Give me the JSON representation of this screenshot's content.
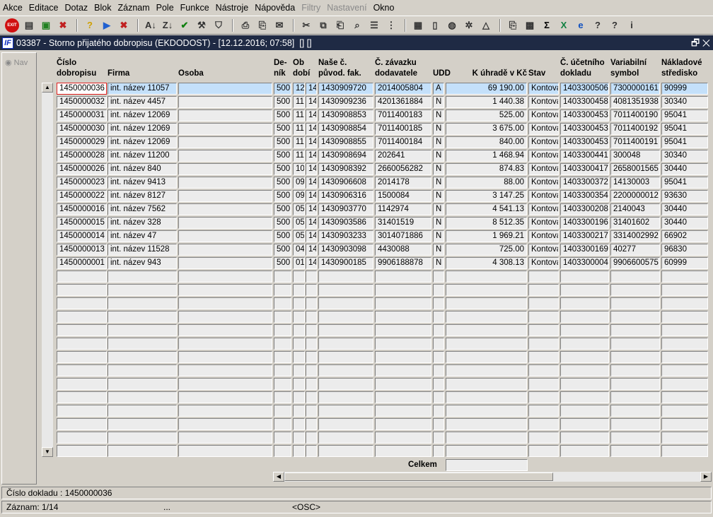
{
  "menu": [
    "Akce",
    "Editace",
    "Dotaz",
    "Blok",
    "Záznam",
    "Pole",
    "Funkce",
    "Nástroje",
    "Nápověda",
    "Filtry",
    "Nastavení",
    "Okno"
  ],
  "menu_disabled": [
    "Filtry",
    "Nastavení"
  ],
  "toolbar": [
    "exit",
    "insert-record",
    "save-record",
    "delete-record",
    "|",
    "query-help",
    "execute-query",
    "cancel-query",
    "|",
    "sort-asc",
    "sort-desc",
    "confirm",
    "tools",
    "filter",
    "|",
    "print",
    "print-setup",
    "mail",
    "|",
    "cut",
    "copy",
    "paste",
    "find",
    "list",
    "tree",
    "|",
    "doc1",
    "doc2",
    "globe",
    "settings",
    "warning",
    "|",
    "attach",
    "calc",
    "sum",
    "excel",
    "browser",
    "help",
    "help2",
    "info"
  ],
  "exit_label": "EXIT",
  "window": {
    "title": "03387 - Storno přijatého dobropisu (EKDODOST) - [12.12.2016; 07:58]  [] []",
    "logo": "IF"
  },
  "nav_label": "Nav",
  "headers": [
    "Číslo\ndobropisu",
    "Firma",
    "Osoba",
    "De-\nník",
    "Ob\ndobí",
    "",
    "Naše č.\npůvod. fak.",
    "Č. závazku\ndodavatele",
    "UDD",
    "K úhradě v Kč",
    "Stav",
    "Č. účetního\ndokladu",
    "Variabilní\nsymbol",
    "Nákladové\nstředisko"
  ],
  "rows": [
    [
      "1450000036",
      "int. název 11057",
      "",
      "500",
      "12",
      "14",
      "1430909720",
      "2014005804",
      "A",
      "69 190.00",
      "Kontová",
      "1403300506",
      "7300000161",
      "90999"
    ],
    [
      "1450000032",
      "int. název 4457",
      "",
      "500",
      "11",
      "14",
      "1430909236",
      "4201361884",
      "N",
      "1 440.38",
      "Kontová",
      "1403300458",
      "4081351938",
      "30340"
    ],
    [
      "1450000031",
      "int. název 12069",
      "",
      "500",
      "11",
      "14",
      "1430908853",
      "7011400183",
      "N",
      "525.00",
      "Kontová",
      "1403300453",
      "7011400190",
      "95041"
    ],
    [
      "1450000030",
      "int. název 12069",
      "",
      "500",
      "11",
      "14",
      "1430908854",
      "7011400185",
      "N",
      "3 675.00",
      "Kontová",
      "1403300453",
      "7011400192",
      "95041"
    ],
    [
      "1450000029",
      "int. název 12069",
      "",
      "500",
      "11",
      "14",
      "1430908855",
      "7011400184",
      "N",
      "840.00",
      "Kontová",
      "1403300453",
      "7011400191",
      "95041"
    ],
    [
      "1450000028",
      "int. název 11200",
      "",
      "500",
      "11",
      "14",
      "1430908694",
      "202641",
      "N",
      "1 468.94",
      "Kontová",
      "1403300441",
      "300048",
      "30340"
    ],
    [
      "1450000026",
      "int. název 840",
      "",
      "500",
      "10",
      "14",
      "1430908392",
      "2660056282",
      "N",
      "874.83",
      "Kontová",
      "1403300417",
      "2658001565",
      "30440"
    ],
    [
      "1450000023",
      "int. název 9413",
      "",
      "500",
      "09",
      "14",
      "1430906608",
      "2014178",
      "N",
      "88.00",
      "Kontová",
      "1403300372",
      "14130003",
      "95041"
    ],
    [
      "1450000022",
      "int. název 8127",
      "",
      "500",
      "09",
      "14",
      "1430906316",
      "1500084",
      "N",
      "3 147.25",
      "Kontová",
      "1403300354",
      "2200000012",
      "93630"
    ],
    [
      "1450000016",
      "int. název 7562",
      "",
      "500",
      "05",
      "14",
      "1430903770",
      "1142974",
      "N",
      "4 541.13",
      "Kontová",
      "1403300208",
      "2140043",
      "30440"
    ],
    [
      "1450000015",
      "int. název 328",
      "",
      "500",
      "05",
      "14",
      "1430903586",
      "31401519",
      "N",
      "8 512.35",
      "Kontová",
      "1403300196",
      "31401602",
      "30440"
    ],
    [
      "1450000014",
      "int. název 47",
      "",
      "500",
      "05",
      "14",
      "1430903233",
      "3014071886",
      "N",
      "1 969.21",
      "Kontová",
      "1403300217",
      "3314002992",
      "66902"
    ],
    [
      "1450000013",
      "int. název 11528",
      "",
      "500",
      "04",
      "14",
      "1430903098",
      "4430088",
      "N",
      "725.00",
      "Kontová",
      "1403300169",
      "40277",
      "96830"
    ],
    [
      "1450000001",
      "int. název 943",
      "",
      "500",
      "01",
      "14",
      "1430900185",
      "9906188878",
      "N",
      "4 308.13",
      "Kontová",
      "1403300004",
      "9906600575",
      "60999"
    ]
  ],
  "total_label": "Celkem",
  "total_value": "",
  "status": {
    "doc": "Číslo dokladu : 1450000036",
    "record": "Záznam: 1/14",
    "dots": "...",
    "mode": "<OSC>"
  }
}
